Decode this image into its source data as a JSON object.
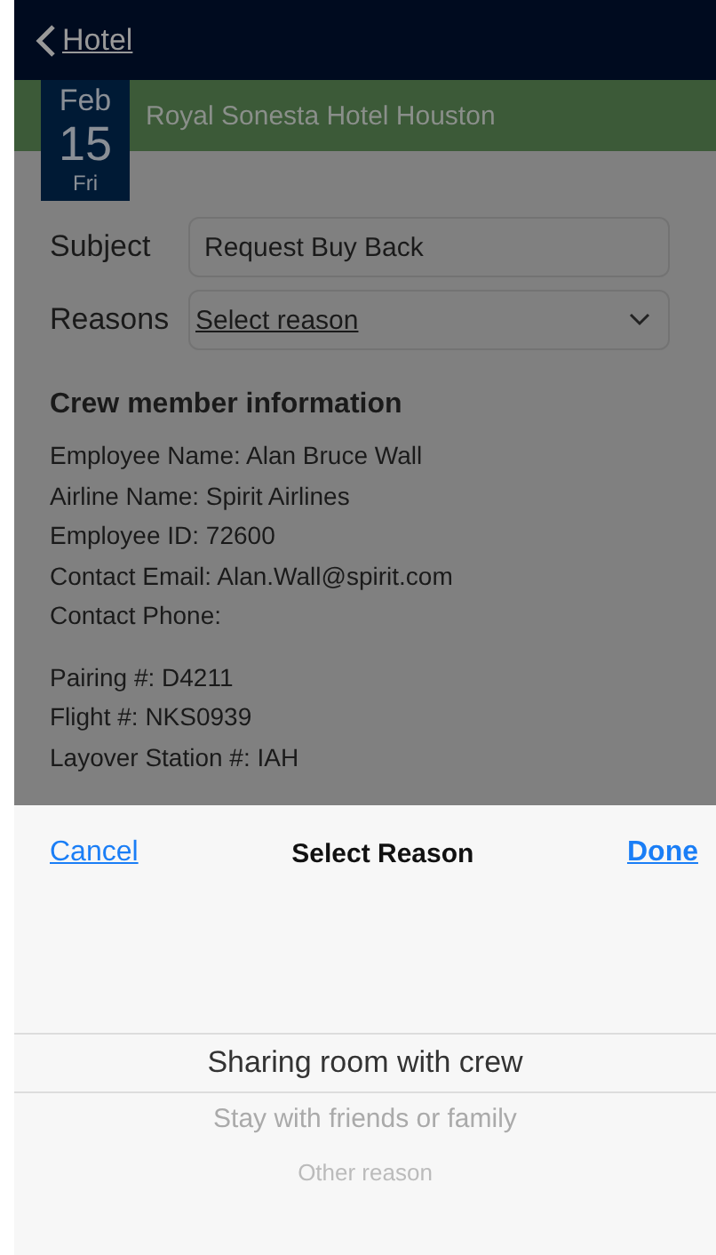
{
  "nav": {
    "back_label": "Hotel"
  },
  "hotel": {
    "month": "Feb",
    "day": "15",
    "weekday": "Fri",
    "name": "Royal Sonesta Hotel Houston"
  },
  "form": {
    "subject": {
      "label": "Subject",
      "value": "Request Buy Back"
    },
    "reasons": {
      "label": "Reasons",
      "value": "Select reason"
    }
  },
  "crew_info": {
    "title": "Crew member information",
    "fields": [
      {
        "label": "Employee Name:",
        "value": "Alan Bruce Wall"
      },
      {
        "label": "Airline Name:",
        "value": "Spirit Airlines"
      },
      {
        "label": "Employee ID:",
        "value": "72600"
      },
      {
        "label": "Contact Email:",
        "value": "Alan.Wall@spirit.com"
      },
      {
        "label": "Contact Phone:"
      }
    ],
    "trip_fields": [
      {
        "label": "Pairing #:",
        "value": "D4211"
      },
      {
        "label": "Flight #:",
        "value": "NKS0939"
      },
      {
        "label": "Layover Station #:",
        "value": "IAH"
      }
    ]
  },
  "picker": {
    "cancel": "Cancel",
    "title": "Select Reason",
    "done": "Done",
    "options": [
      {
        "label": "Sharing room with crew",
        "selected": true
      },
      {
        "label": "Stay with friends or family",
        "selected": false
      },
      {
        "label": "Other reason",
        "selected": false
      }
    ]
  }
}
